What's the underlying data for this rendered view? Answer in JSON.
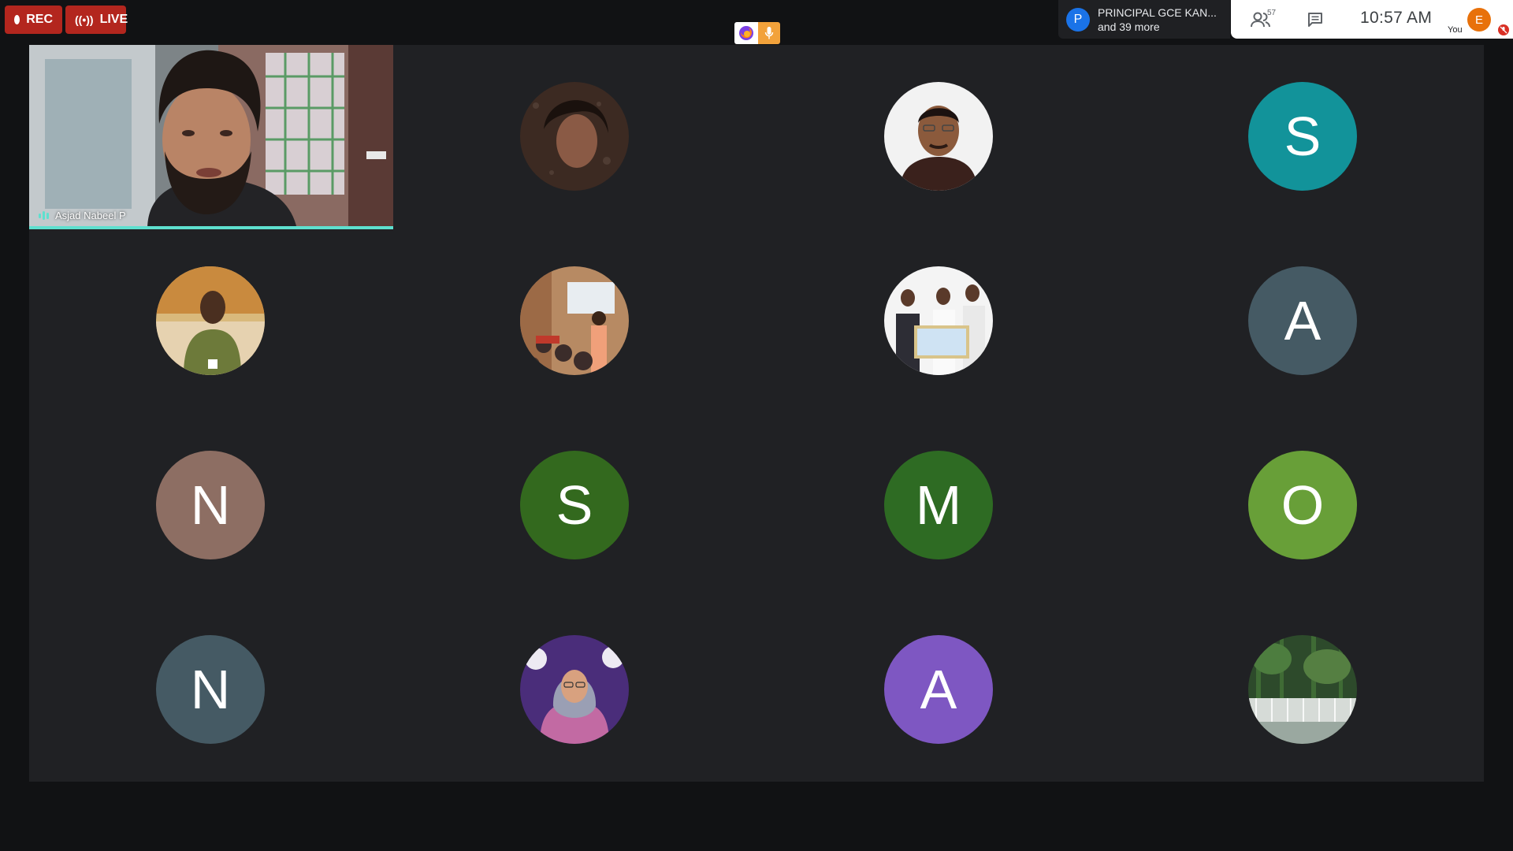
{
  "recording": {
    "rec_label": "REC",
    "live_label": "LIVE"
  },
  "presenter": {
    "initial": "P",
    "name": "PRINCIPAL GCE KAN...",
    "subtitle": "and 39 more"
  },
  "toolbar": {
    "people_count": "57",
    "time": "10:57  AM",
    "self_initial": "E",
    "self_label": "You"
  },
  "featured": {
    "name": "Asjad Nabeel P"
  },
  "participants": [
    {
      "id": "p2",
      "kind": "photo",
      "icon": "portrait-photo"
    },
    {
      "id": "p3",
      "kind": "photo",
      "icon": "portrait-photo"
    },
    {
      "id": "p4",
      "kind": "letter",
      "letter": "S",
      "color": "#12939a"
    },
    {
      "id": "p5",
      "kind": "photo",
      "icon": "portrait-photo"
    },
    {
      "id": "p6",
      "kind": "photo",
      "icon": "classroom-photo"
    },
    {
      "id": "p7",
      "kind": "photo",
      "icon": "award-photo"
    },
    {
      "id": "p8",
      "kind": "letter",
      "letter": "A",
      "color": "#455a64"
    },
    {
      "id": "p9",
      "kind": "letter",
      "letter": "N",
      "color": "#8d6e63"
    },
    {
      "id": "p10",
      "kind": "letter",
      "letter": "S",
      "color": "#33691e"
    },
    {
      "id": "p11",
      "kind": "letter",
      "letter": "M",
      "color": "#2e6b23"
    },
    {
      "id": "p12",
      "kind": "letter",
      "letter": "O",
      "color": "#689f38"
    },
    {
      "id": "p13",
      "kind": "letter",
      "letter": "N",
      "color": "#455a64"
    },
    {
      "id": "p14",
      "kind": "photo",
      "icon": "portrait-photo"
    },
    {
      "id": "p15",
      "kind": "letter",
      "letter": "A",
      "color": "#7e57c2"
    },
    {
      "id": "p16",
      "kind": "photo",
      "icon": "waterfall-photo"
    }
  ],
  "colors": {
    "speaking": "#5ee0cf",
    "record": "#b3261e",
    "grid_bg": "#202124"
  }
}
